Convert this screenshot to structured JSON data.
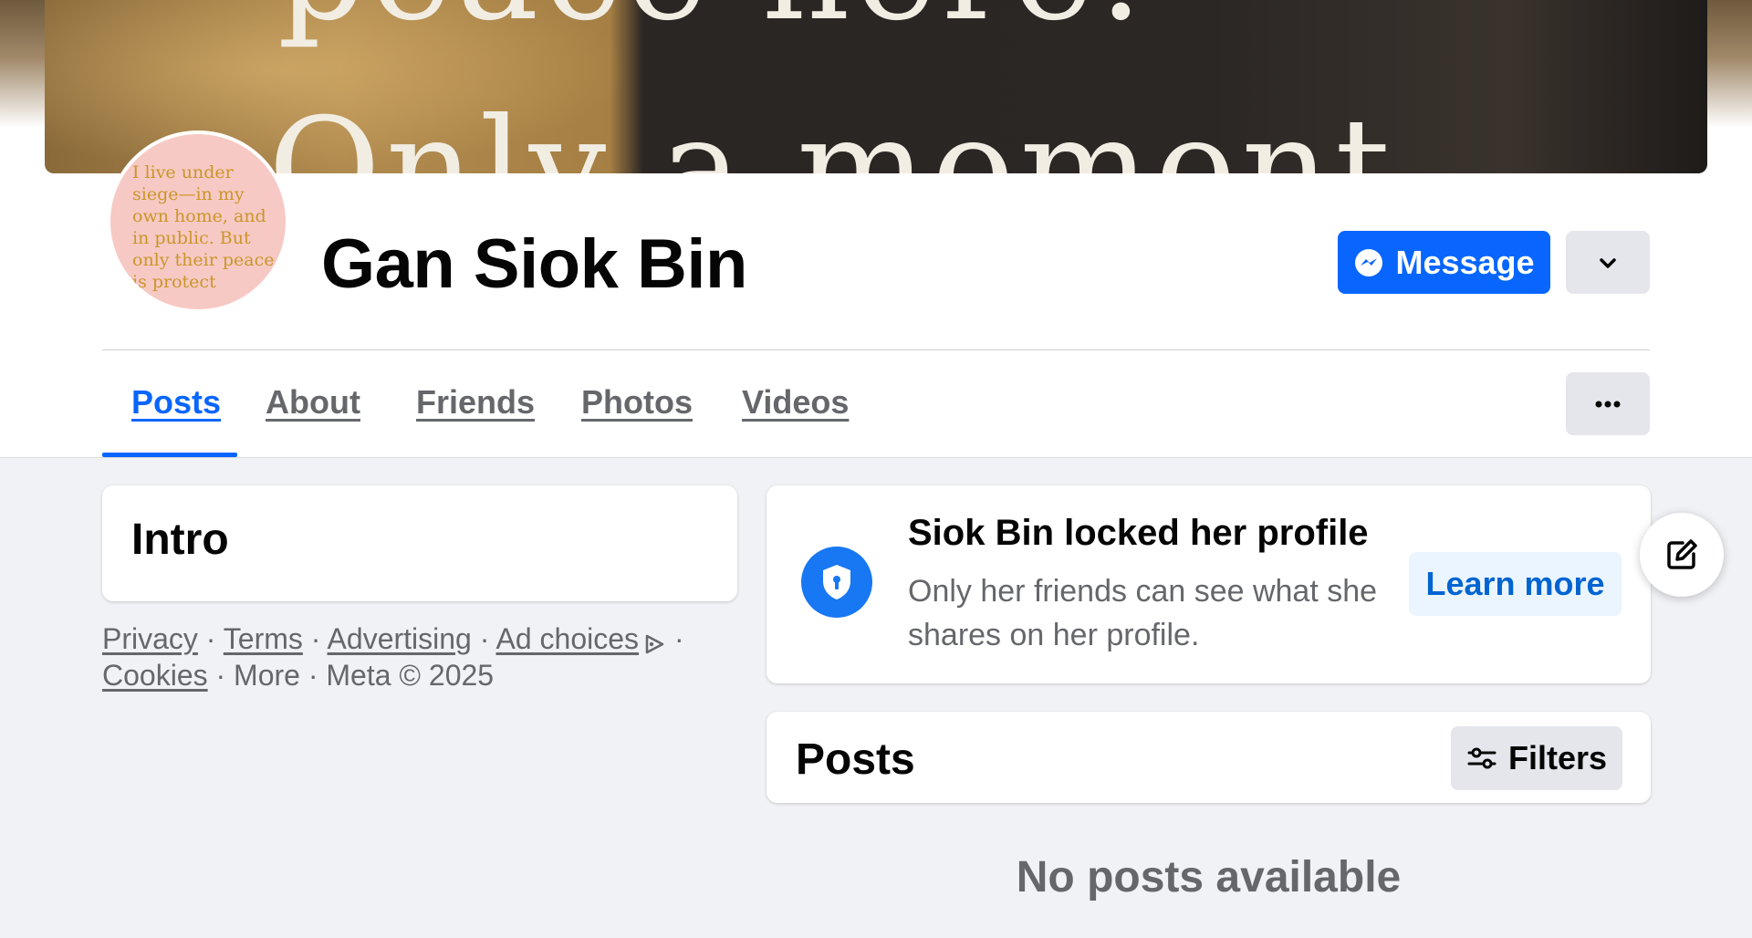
{
  "cover": {
    "line1": "peace here.",
    "line2": "Only a moment"
  },
  "avatar": {
    "text": "I live under siege—in my own home, and in public. But only their peace is protect"
  },
  "profile": {
    "name": "Gan Siok Bin"
  },
  "actions": {
    "message_label": "Message",
    "dropdown_icon": "chevron-down-icon",
    "more_icon": "more-dots-icon"
  },
  "tabs": [
    {
      "label": "Posts",
      "active": true
    },
    {
      "label": "About",
      "active": false
    },
    {
      "label": "Friends",
      "active": false
    },
    {
      "label": "Photos",
      "active": false
    },
    {
      "label": "Videos",
      "active": false
    }
  ],
  "intro": {
    "title": "Intro"
  },
  "footer": {
    "privacy": "Privacy",
    "terms": "Terms",
    "advertising": "Advertising",
    "ad_choices": "Ad choices",
    "cookies": "Cookies",
    "more": "More",
    "meta": "Meta © 2025",
    "sep": "·"
  },
  "locked": {
    "title": "Siok Bin locked her profile",
    "description": "Only her friends can see what she shares on her profile.",
    "learn_more": "Learn more"
  },
  "posts": {
    "title": "Posts",
    "filters_label": "Filters",
    "empty_text": "No posts available"
  },
  "colors": {
    "accent": "#0866ff",
    "secondary_text": "#65676b",
    "background": "#f0f2f5"
  }
}
